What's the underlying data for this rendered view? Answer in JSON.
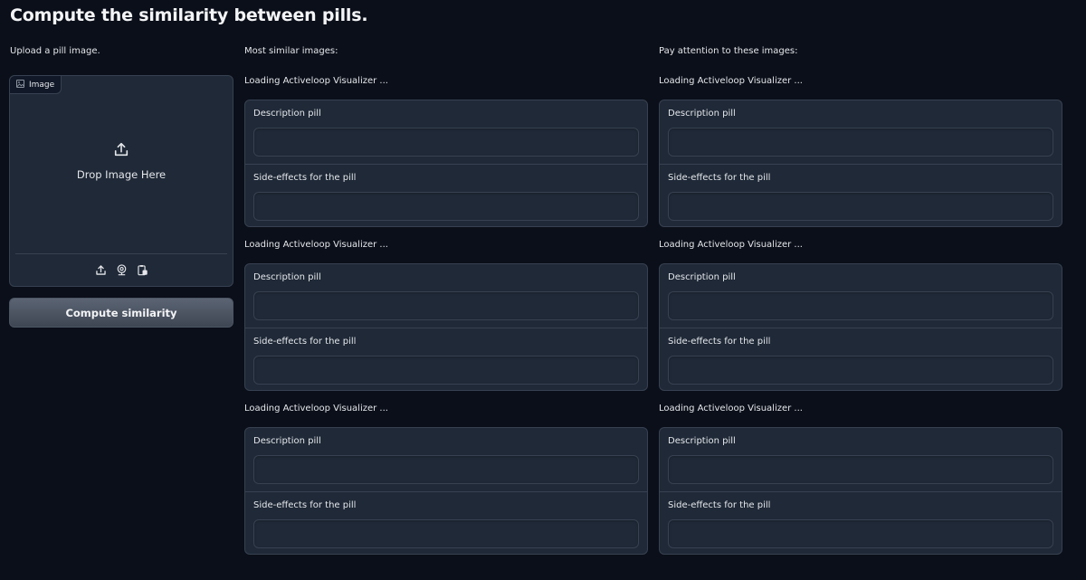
{
  "page": {
    "title": "Compute the similarity between pills."
  },
  "left": {
    "label": "Upload a pill image.",
    "image_chip": "Image",
    "drop_text": "Drop Image Here",
    "tools": [
      "upload-icon",
      "webcam-icon",
      "clipboard-icon"
    ],
    "button": "Compute similarity"
  },
  "middle": {
    "label": "Most similar images:",
    "items": [
      {
        "loading": "Loading Activeloop Visualizer ...",
        "desc_label": "Description pill",
        "desc_value": "",
        "side_label": "Side-effects for the pill",
        "side_value": ""
      },
      {
        "loading": "Loading Activeloop Visualizer ...",
        "desc_label": "Description pill",
        "desc_value": "",
        "side_label": "Side-effects for the pill",
        "side_value": ""
      },
      {
        "loading": "Loading Activeloop Visualizer ...",
        "desc_label": "Description pill",
        "desc_value": "",
        "side_label": "Side-effects for the pill",
        "side_value": ""
      }
    ]
  },
  "right": {
    "label": "Pay attention to these images:",
    "items": [
      {
        "loading": "Loading Activeloop Visualizer ...",
        "desc_label": "Description pill",
        "desc_value": "",
        "side_label": "Side-effects for the pill",
        "side_value": ""
      },
      {
        "loading": "Loading Activeloop Visualizer ...",
        "desc_label": "Description pill",
        "desc_value": "",
        "side_label": "Side-effects for the pill",
        "side_value": ""
      },
      {
        "loading": "Loading Activeloop Visualizer ...",
        "desc_label": "Description pill",
        "desc_value": "",
        "side_label": "Side-effects for the pill",
        "side_value": ""
      }
    ]
  }
}
